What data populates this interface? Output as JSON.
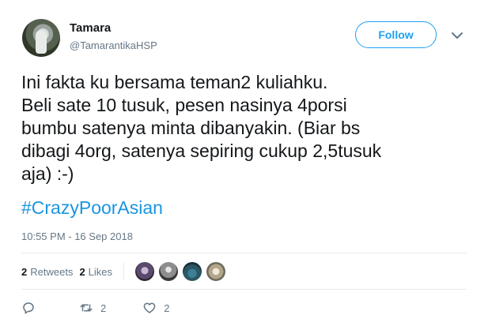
{
  "user": {
    "name": "Tamara",
    "handle": "@TamarantikaHSP"
  },
  "follow_label": "Follow",
  "tweet": {
    "text": "Ini fakta ku bersama teman2 kuliahku.\nBeli sate 10 tusuk, pesen nasinya 4porsi\nbumbu satenya minta dibanyakin. (Biar bs\ndibagi 4org, satenya sepiring cukup 2,5tusuk\naja) :-)",
    "hashtag": "#CrazyPoorAsian",
    "timestamp": "10:55 PM - 16 Sep 2018"
  },
  "stats": {
    "retweets_count": "2",
    "retweets_label": "Retweets",
    "likes_count": "2",
    "likes_label": "Likes"
  },
  "actions": {
    "reply_icon": "reply-icon",
    "retweet_icon": "retweet-icon",
    "retweet_count": "2",
    "like_icon": "heart-icon",
    "like_count": "2"
  },
  "colors": {
    "accent": "#1da1f2",
    "hashtag": "#1b95e0",
    "secondary_text": "#657786",
    "divider": "#e6ecf0"
  }
}
